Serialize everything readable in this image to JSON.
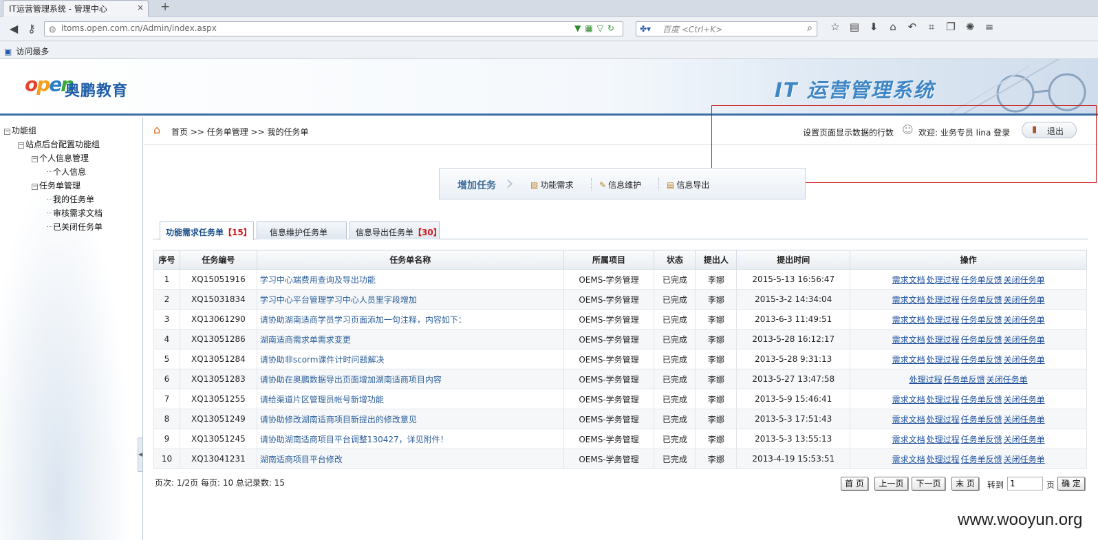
{
  "browser": {
    "tab_title": "IT运营管理系统 - 管理中心",
    "tab_close": "×",
    "new_tab": "+",
    "url": "itoms.open.com.cn/Admin/index.aspx",
    "search_engine": "百度",
    "search_placeholder": "<Ctrl+K>",
    "bookmark": "访问最多"
  },
  "header": {
    "logo_text": "奥鹏教育",
    "system_title": "IT 运营管理系统"
  },
  "sidebar": {
    "root": "功能组",
    "group": "站点后台配置功能组",
    "personal": "个人信息管理",
    "personal_info": "个人信息",
    "task_mgmt": "任务单管理",
    "my_tasks": "我的任务单",
    "review_docs": "审核需求文档",
    "closed_tasks": "已关闭任务单"
  },
  "topbar": {
    "breadcrumb": "首页 >> 任务单管理 >> 我的任务单",
    "setting": "设置页面显示数据的行数",
    "welcome": "欢迎: 业务专员 lina 登录",
    "logout": "退出"
  },
  "actions": {
    "add_task": "增加任务",
    "func": "功能需求",
    "info_maint": "信息维护",
    "info_export": "信息导出"
  },
  "tabs": [
    {
      "label": "功能需求任务单",
      "count": "【15】"
    },
    {
      "label": "信息维护任务单",
      "count": ""
    },
    {
      "label": "信息导出任务单",
      "count": "【30】"
    }
  ],
  "table": {
    "headers": [
      "序号",
      "任务编号",
      "任务单名称",
      "所属项目",
      "状态",
      "提出人",
      "提出时间",
      "操作"
    ],
    "op_labels": [
      "需求文档",
      "处理过程",
      "任务单反馈",
      "关闭任务单"
    ],
    "rows": [
      {
        "no": "1",
        "code": "XQ15051916",
        "name": "学习中心端费用查询及导出功能",
        "project": "OEMS-学务管理",
        "status": "已完成",
        "by": "李娜",
        "time": "2015-5-13 16:56:47"
      },
      {
        "no": "2",
        "code": "XQ15031834",
        "name": "学习中心平台管理学习中心人员里字段增加",
        "project": "OEMS-学务管理",
        "status": "已完成",
        "by": "李娜",
        "time": "2015-3-2 14:34:04"
      },
      {
        "no": "3",
        "code": "XQ13061290",
        "name": "请协助湖南适商学员学习页面添加一句注释，内容如下：",
        "project": "OEMS-学务管理",
        "status": "已完成",
        "by": "李娜",
        "time": "2013-6-3 11:49:51"
      },
      {
        "no": "4",
        "code": "XQ13051286",
        "name": "湖南适商需求单需求变更",
        "project": "OEMS-学务管理",
        "status": "已完成",
        "by": "李娜",
        "time": "2013-5-28 16:12:17"
      },
      {
        "no": "5",
        "code": "XQ13051284",
        "name": "请协助非scorm课件计时问题解决",
        "project": "OEMS-学务管理",
        "status": "已完成",
        "by": "李娜",
        "time": "2013-5-28 9:31:13"
      },
      {
        "no": "6",
        "code": "XQ13051283",
        "name": "请协助在奥鹏数据导出页面增加湖南适商项目内容",
        "project": "OEMS-学务管理",
        "status": "已完成",
        "by": "李娜",
        "time": "2013-5-27 13:47:58"
      },
      {
        "no": "7",
        "code": "XQ13051255",
        "name": "请给渠道片区管理员帐号新增功能",
        "project": "OEMS-学务管理",
        "status": "已完成",
        "by": "李娜",
        "time": "2013-5-9 15:46:41"
      },
      {
        "no": "8",
        "code": "XQ13051249",
        "name": "请协助修改湖南适商项目新提出的修改意见",
        "project": "OEMS-学务管理",
        "status": "已完成",
        "by": "李娜",
        "time": "2013-5-3 17:51:43"
      },
      {
        "no": "9",
        "code": "XQ13051245",
        "name": "请协助湖南适商项目平台调整130427，详见附件！",
        "project": "OEMS-学务管理",
        "status": "已完成",
        "by": "李娜",
        "time": "2013-5-3 13:55:13"
      },
      {
        "no": "10",
        "code": "XQ13041231",
        "name": "湖南适商项目平台修改",
        "project": "OEMS-学务管理",
        "status": "已完成",
        "by": "李娜",
        "time": "2013-4-19 15:53:51"
      }
    ]
  },
  "pager": {
    "info": "页次: 1/2页 每页: 10 总记录数: 15",
    "first": "首 页",
    "prev": "上一页",
    "next": "下一页",
    "last": "末 页",
    "goto": "转到",
    "goto_value": "1",
    "page": "页",
    "confirm": "确 定"
  },
  "watermark": "www.wooyun.org"
}
